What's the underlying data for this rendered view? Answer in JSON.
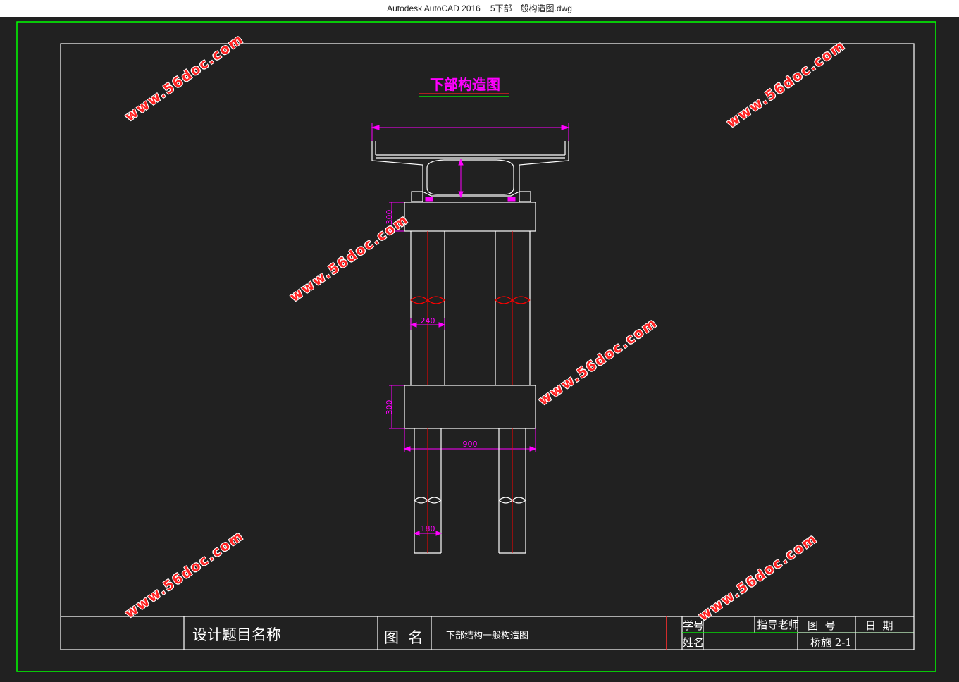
{
  "window": {
    "app_title": "Autodesk AutoCAD 2016",
    "file_name": "5下部一般构造图.dwg"
  },
  "drawing": {
    "title": "下部构造图",
    "dimensions": {
      "cap_height": "300",
      "column_diameter": "240",
      "tie_beam_height": "300",
      "tie_beam_width": "900",
      "pile_diameter": "180"
    }
  },
  "title_block": {
    "project_name_label": "设计题目名称",
    "drawing_name_label": "图  名",
    "drawing_name_value": "下部结构一般构造图",
    "student_id_label": "学号",
    "name_label": "姓名",
    "advisor_label": "指导老师",
    "drawing_no_label": "图  号",
    "drawing_no_value": "桥施 2-1",
    "date_label": "日  期"
  },
  "watermark": {
    "text": "www.56doc.com"
  },
  "colors": {
    "background": "#212121",
    "line": "#ffffff",
    "dimension": "#ff00ff",
    "centerline": "#ff0000",
    "frame": "#00ff00"
  }
}
